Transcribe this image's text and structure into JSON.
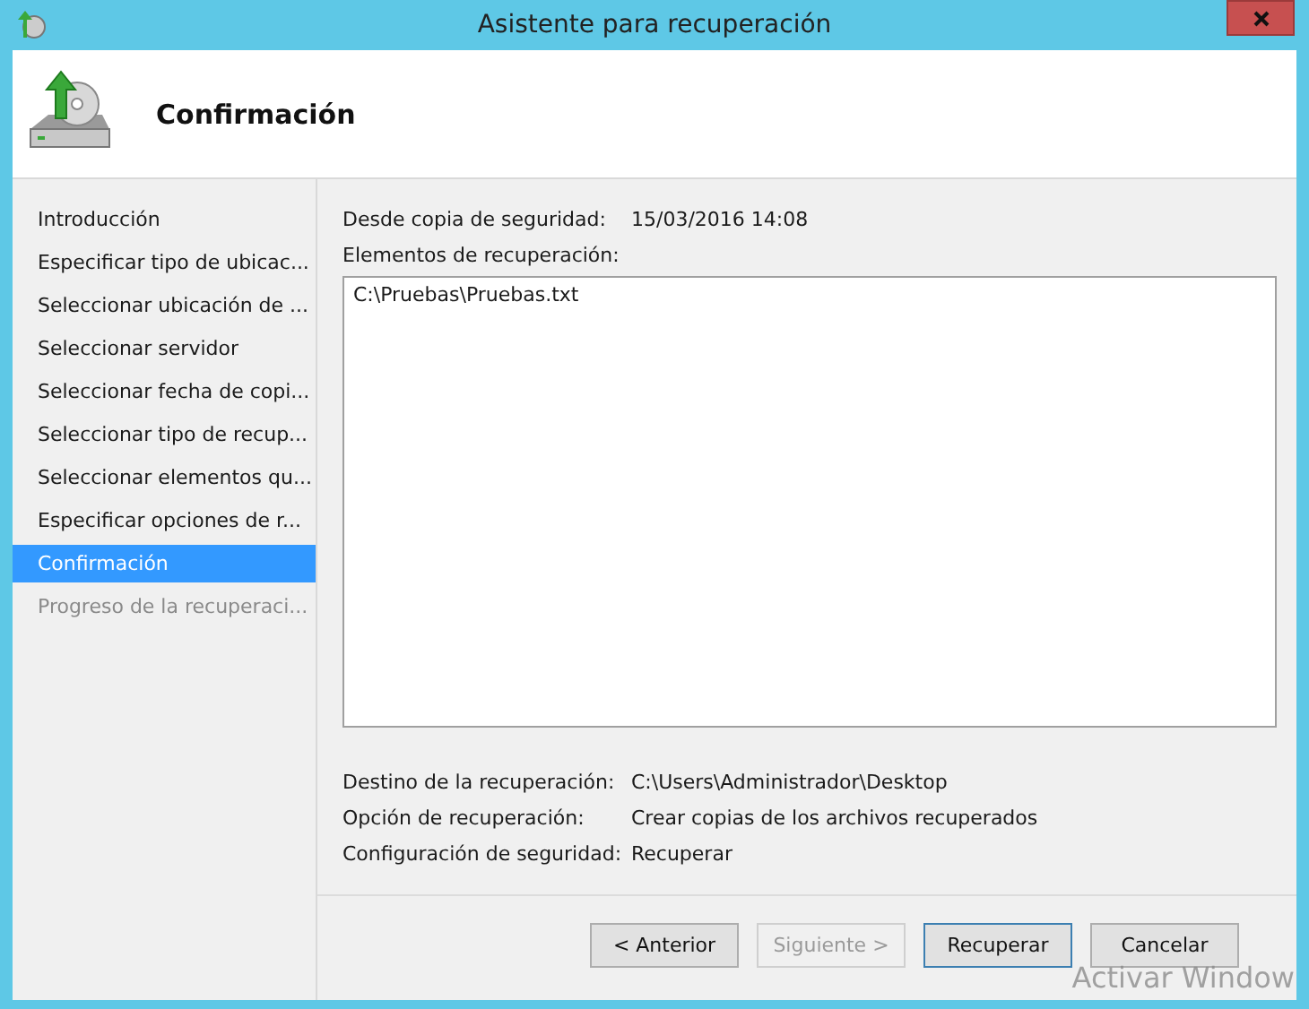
{
  "window": {
    "title": "Asistente para recuperación"
  },
  "header": {
    "title": "Confirmación"
  },
  "sidebar": {
    "items": [
      {
        "label": "Introducción",
        "selected": false,
        "disabled": false
      },
      {
        "label": "Especificar tipo de ubicac...",
        "selected": false,
        "disabled": false
      },
      {
        "label": "Seleccionar ubicación de ...",
        "selected": false,
        "disabled": false
      },
      {
        "label": "Seleccionar servidor",
        "selected": false,
        "disabled": false
      },
      {
        "label": "Seleccionar fecha de copi...",
        "selected": false,
        "disabled": false
      },
      {
        "label": "Seleccionar tipo de recup...",
        "selected": false,
        "disabled": false
      },
      {
        "label": "Seleccionar elementos qu...",
        "selected": false,
        "disabled": false
      },
      {
        "label": "Especificar opciones de r...",
        "selected": false,
        "disabled": false
      },
      {
        "label": "Confirmación",
        "selected": true,
        "disabled": false
      },
      {
        "label": "Progreso de la recuperaci...",
        "selected": false,
        "disabled": true
      }
    ]
  },
  "backup": {
    "label": "Desde copia de seguridad:",
    "value": "15/03/2016 14:08"
  },
  "items": {
    "label": "Elementos de recuperación:",
    "entries": [
      "C:\\Pruebas\\Pruebas.txt"
    ]
  },
  "summary": [
    {
      "label": "Destino de la recuperación:",
      "value": "C:\\Users\\Administrador\\Desktop"
    },
    {
      "label": "Opción de recuperación:",
      "value": "Crear copias de los archivos recuperados"
    },
    {
      "label": "Configuración de seguridad:",
      "value": "Recuperar"
    }
  ],
  "buttons": [
    {
      "label": "< Anterior",
      "disabled": false,
      "default": false
    },
    {
      "label": "Siguiente >",
      "disabled": true,
      "default": false
    },
    {
      "label": "Recuperar",
      "disabled": false,
      "default": true
    },
    {
      "label": "Cancelar",
      "disabled": false,
      "default": false
    }
  ],
  "os_notice": "Activar Window"
}
